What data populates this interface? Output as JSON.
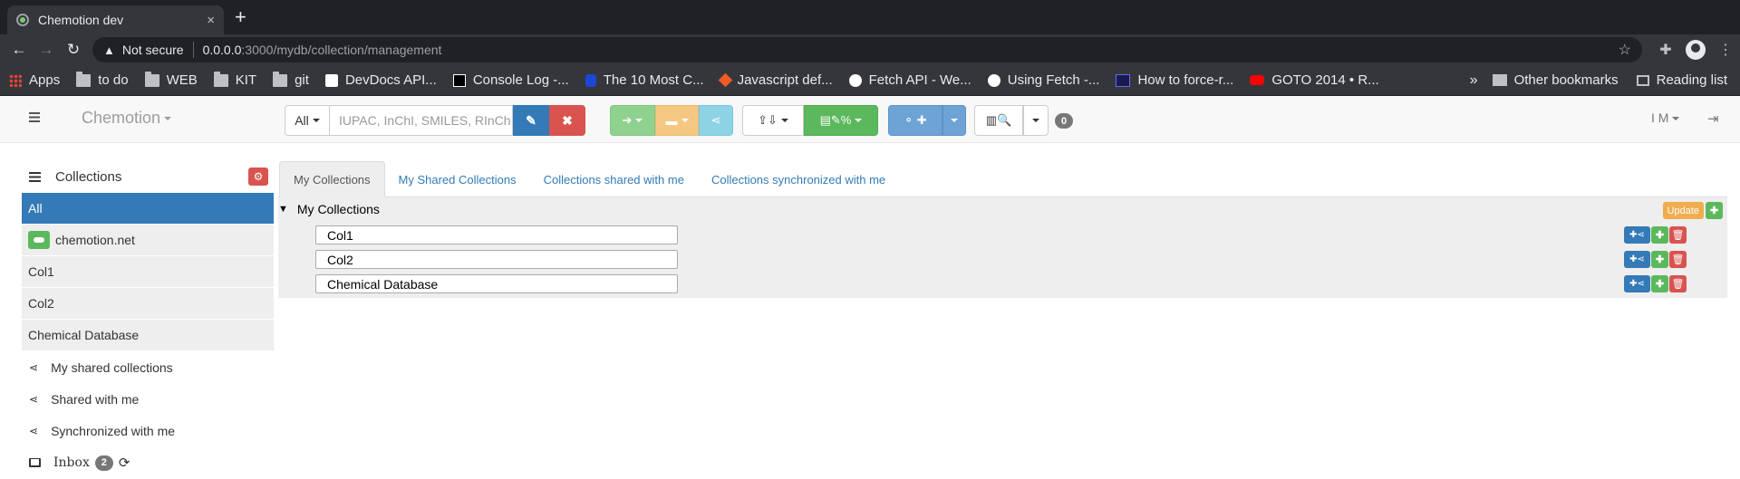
{
  "browser": {
    "tab_title": "Chemotion dev",
    "tab_close": "×",
    "new_tab": "+",
    "security_label": "Not secure",
    "url_host": "0.0.0.0",
    "url_path": ":3000/mydb/collection/management",
    "bookmarks": [
      {
        "label": "Apps",
        "icon": "apps-grid-icon"
      },
      {
        "label": "to do",
        "icon": "folder-icon"
      },
      {
        "label": "WEB",
        "icon": "folder-icon"
      },
      {
        "label": "KIT",
        "icon": "folder-icon"
      },
      {
        "label": "git",
        "icon": "folder-icon"
      },
      {
        "label": "DevDocs API...",
        "icon": "devdocs-icon"
      },
      {
        "label": "Console Log -...",
        "icon": "jetbrains-icon"
      },
      {
        "label": "The 10 Most C...",
        "icon": "site-icon"
      },
      {
        "label": "Javascript def...",
        "icon": "site-icon"
      },
      {
        "label": "Fetch API - We...",
        "icon": "mdn-icon"
      },
      {
        "label": "Using Fetch -...",
        "icon": "mdn-icon"
      },
      {
        "label": "How to force-r...",
        "icon": "site-icon"
      },
      {
        "label": "GOTO 2014 • R...",
        "icon": "youtube-icon"
      }
    ],
    "bookmarks_more": "»",
    "other_bookmarks": "Other bookmarks",
    "reading_list": "Reading list"
  },
  "navbar": {
    "brand": "Chemotion",
    "search_scope": "All",
    "search_placeholder": "IUPAC, InChI, SMILES, RInChI...",
    "badge": "0",
    "user": "I M"
  },
  "sidebar": {
    "title": "Collections",
    "items": [
      {
        "label": "All",
        "active": true
      },
      {
        "label": "chemotion.net",
        "active": false
      },
      {
        "label": "Col1",
        "active": false
      },
      {
        "label": "Col2",
        "active": false
      },
      {
        "label": "Chemical Database",
        "active": false
      }
    ],
    "links": [
      {
        "label": "My shared collections"
      },
      {
        "label": "Shared with me"
      },
      {
        "label": "Synchronized with me"
      }
    ],
    "inbox_label": "Inbox",
    "inbox_count": "2"
  },
  "main": {
    "tabs": [
      {
        "label": "My Collections",
        "active": true
      },
      {
        "label": "My Shared Collections",
        "active": false
      },
      {
        "label": "Collections shared with me",
        "active": false
      },
      {
        "label": "Collections synchronized with me",
        "active": false
      }
    ],
    "root_label": "My Collections",
    "update_label": "Update",
    "collections": [
      {
        "name": "Col1"
      },
      {
        "name": "Col2"
      },
      {
        "name": "Chemical Database"
      }
    ]
  },
  "colors": {
    "primary": "#337ab7",
    "success": "#5cb85c",
    "danger": "#d9534f",
    "warning": "#f0ad4e"
  }
}
